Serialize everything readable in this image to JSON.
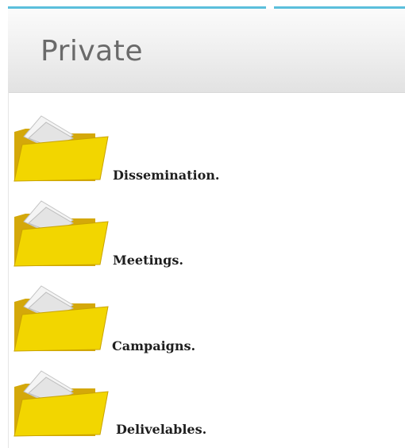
{
  "header": {
    "title": "Private"
  },
  "folders": [
    {
      "label": "Dissemination."
    },
    {
      "label": "Meetings."
    },
    {
      "label": "Campaigns."
    },
    {
      "label": "Delivelables."
    }
  ],
  "colors": {
    "accent_line": "#5bbfdc",
    "folder_front": "#f2d600",
    "folder_back": "#d4a80a",
    "header_text": "#6a6a6a"
  },
  "icons": {
    "folder": "folder-icon"
  }
}
